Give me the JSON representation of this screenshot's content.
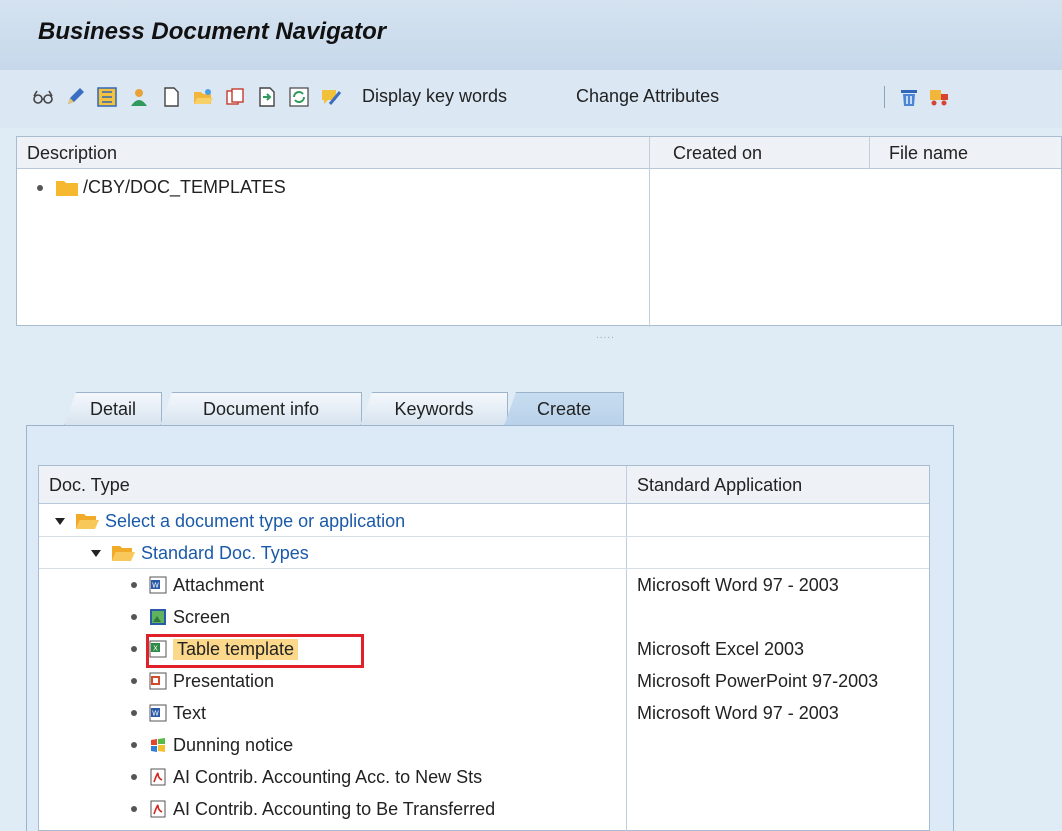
{
  "window": {
    "title": "Business Document Navigator"
  },
  "toolbar": {
    "icons": [
      "glasses-icon",
      "pencil-icon",
      "structure-icon",
      "person-icon",
      "new-document-icon",
      "open-folder-icon",
      "copy-icon",
      "export-icon",
      "refresh-icon",
      "checkin-icon"
    ],
    "display_keywords": "Display key words",
    "change_attributes": "Change Attributes",
    "trailing_icons": [
      "delete-icon",
      "transport-icon"
    ]
  },
  "upper_grid": {
    "columns": [
      "Description",
      "Created on",
      "File name"
    ],
    "rows": [
      {
        "label": "/CBY/DOC_TEMPLATES"
      }
    ]
  },
  "splitter": ".....",
  "tabs": [
    {
      "label": "Detail",
      "active": false
    },
    {
      "label": "Document info",
      "active": false
    },
    {
      "label": "Keywords",
      "active": false
    },
    {
      "label": "Create",
      "active": true
    }
  ],
  "lower_grid": {
    "columns": [
      "Doc. Type",
      "Standard Application"
    ],
    "group1": "Select a document type or application",
    "group2": "Standard Doc. Types",
    "items": [
      {
        "label": "Attachment",
        "app": "Microsoft Word 97 - 2003",
        "icon": "word-doc-icon"
      },
      {
        "label": "Screen",
        "app": "",
        "icon": "screen-image-icon"
      },
      {
        "label": "Table template",
        "app": "Microsoft Excel 2003",
        "icon": "excel-doc-icon",
        "selected": true
      },
      {
        "label": "Presentation",
        "app": "Microsoft PowerPoint 97-2003",
        "icon": "powerpoint-doc-icon"
      },
      {
        "label": "Text",
        "app": "Microsoft Word 97 - 2003",
        "icon": "word-doc-icon"
      },
      {
        "label": "Dunning notice",
        "app": "",
        "icon": "windows-icon"
      },
      {
        "label": "AI Contrib. Accounting Acc. to New Sts",
        "app": "",
        "icon": "pdf-icon"
      },
      {
        "label": "AI Contrib. Accounting to Be Transferred",
        "app": "",
        "icon": "pdf-icon"
      }
    ]
  },
  "colors": {
    "highlight": "#fbd88a",
    "annotation_box": "#e0202a",
    "link_blue": "#1a5aa8"
  }
}
